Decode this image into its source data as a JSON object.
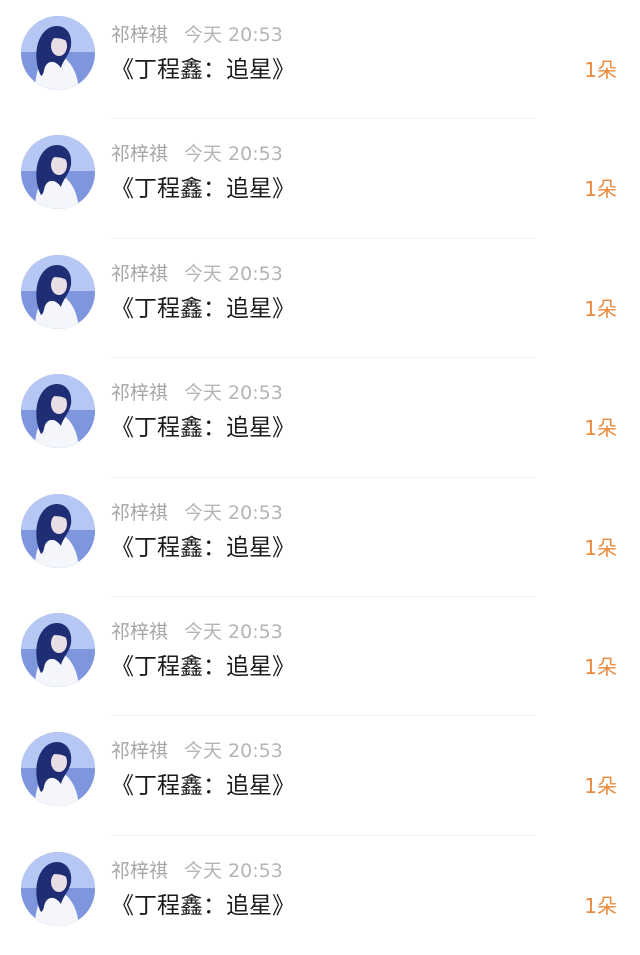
{
  "records": [
    {
      "name": "祁梓祺",
      "time": "今天 20:53",
      "gift": "《丁程鑫：追星》",
      "count": "1朵",
      "avatar": "user-avatar-photo"
    },
    {
      "name": "祁梓祺",
      "time": "今天 20:53",
      "gift": "《丁程鑫：追星》",
      "count": "1朵",
      "avatar": "user-avatar-photo"
    },
    {
      "name": "祁梓祺",
      "time": "今天 20:53",
      "gift": "《丁程鑫：追星》",
      "count": "1朵",
      "avatar": "user-avatar-photo"
    },
    {
      "name": "祁梓祺",
      "time": "今天 20:53",
      "gift": "《丁程鑫：追星》",
      "count": "1朵",
      "avatar": "user-avatar-photo"
    },
    {
      "name": "祁梓祺",
      "time": "今天 20:53",
      "gift": "《丁程鑫：追星》",
      "count": "1朵",
      "avatar": "user-avatar-photo"
    },
    {
      "name": "祁梓祺",
      "time": "今天 20:53",
      "gift": "《丁程鑫：追星》",
      "count": "1朵",
      "avatar": "user-avatar-photo"
    },
    {
      "name": "祁梓祺",
      "time": "今天 20:53",
      "gift": "《丁程鑫：追星》",
      "count": "1朵",
      "avatar": "user-avatar-photo"
    },
    {
      "name": "祁梓祺",
      "time": "今天 20:53",
      "gift": "《丁程鑫：追星》",
      "count": "1朵",
      "avatar": "user-avatar-photo"
    }
  ],
  "colors": {
    "count_accent": "#ea8a3e",
    "name_gray": "#a6a6a6",
    "time_gray": "#b5b5b5",
    "gift_text": "#1c1c1c"
  }
}
